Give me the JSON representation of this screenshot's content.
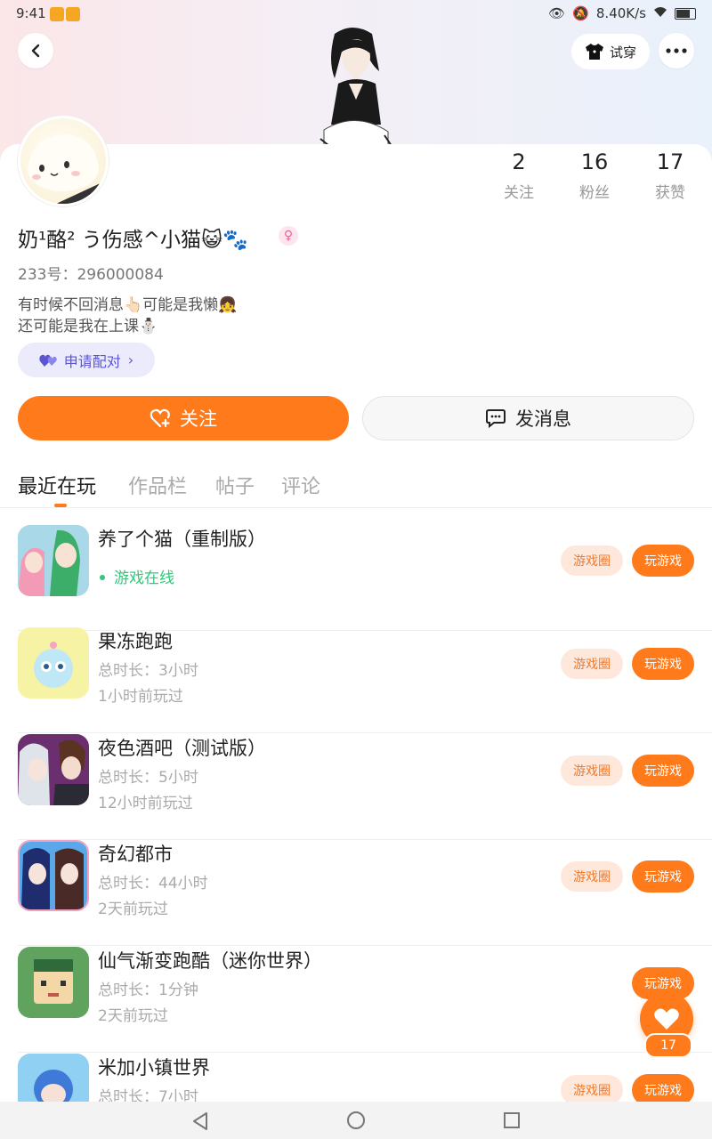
{
  "status_bar": {
    "time": "9:41",
    "speed": "8.40K/s"
  },
  "header": {
    "try_on_label": "试穿"
  },
  "stats": [
    {
      "value": "2",
      "label": "关注"
    },
    {
      "value": "16",
      "label": "粉丝"
    },
    {
      "value": "17",
      "label": "获赞"
    }
  ],
  "profile": {
    "name": "奶¹酪² う伤感^小猫😺🐾",
    "gender_symbol": "♀",
    "id_text": "233号：296000084",
    "bio_line1": "有时候不回消息👆🏻可能是我懒👧",
    "bio_line2": "还可能是我在上课⛄"
  },
  "actions": {
    "pair_label": "申请配对",
    "follow_label": "关注",
    "message_label": "发消息"
  },
  "tabs": [
    "最近在玩",
    "作品栏",
    "帖子",
    "评论"
  ],
  "games": [
    {
      "name": "养了个猫（重制版）",
      "status": "游戏在线",
      "circle": "游戏圈",
      "play": "玩游戏"
    },
    {
      "name": "果冻跑跑",
      "duration": "总时长：3小时",
      "last_played": "1小时前玩过",
      "circle": "游戏圈",
      "play": "玩游戏"
    },
    {
      "name": "夜色酒吧（测试版）",
      "duration": "总时长：5小时",
      "last_played": "12小时前玩过",
      "circle": "游戏圈",
      "play": "玩游戏"
    },
    {
      "name": "奇幻都市",
      "duration": "总时长：44小时",
      "last_played": "2天前玩过",
      "circle": "游戏圈",
      "play": "玩游戏"
    },
    {
      "name": "仙气渐变跑酷（迷你世界）",
      "duration": "总时长：1分钟",
      "last_played": "2天前玩过",
      "play": "玩游戏"
    },
    {
      "name": "米加小镇世界",
      "duration": "总时长：7小时",
      "circle": "游戏圈",
      "play": "玩游戏"
    }
  ],
  "fab": {
    "count": "17"
  },
  "colors": {
    "accent": "#ff7a1a",
    "online": "#2fc77a",
    "pair": "#5b55d6"
  }
}
